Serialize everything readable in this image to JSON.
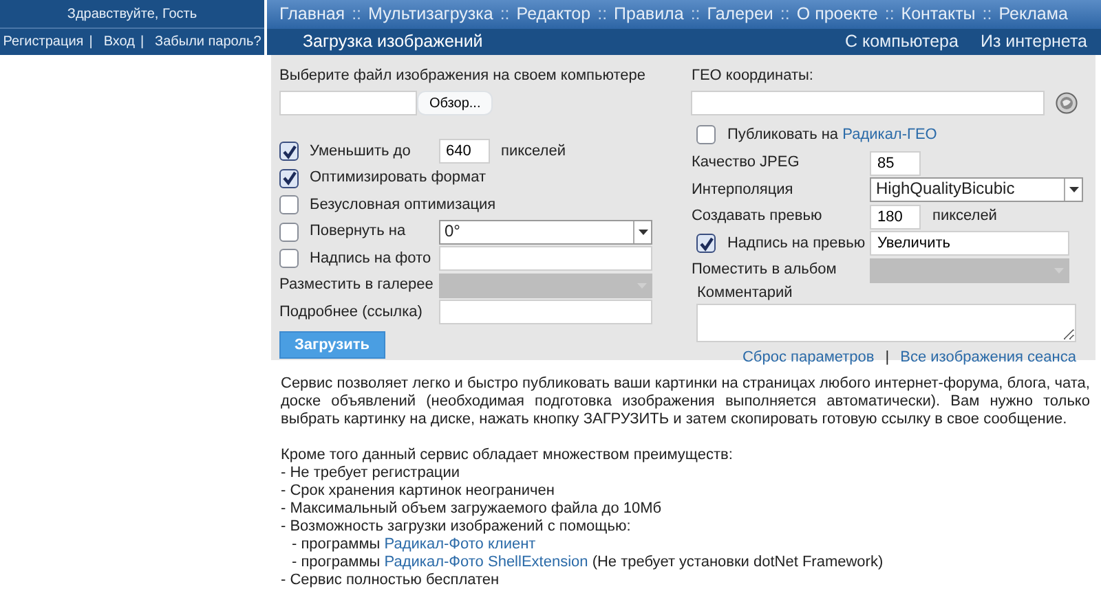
{
  "sidebar": {
    "greeting": "Здравствуйте, Гость",
    "links": [
      {
        "label": "Регистрация",
        "separator": "|"
      },
      {
        "label": "Вход",
        "separator": "|"
      },
      {
        "label": "Забыли пароль?"
      }
    ]
  },
  "nav": {
    "items": [
      {
        "label": "Главная"
      },
      {
        "label": "Мультизагрузка",
        "separator": "::"
      },
      {
        "label": "Редактор",
        "separator": "::"
      },
      {
        "label": "Правила",
        "separator": "::"
      },
      {
        "label": "Галереи",
        "separator": "::"
      },
      {
        "label": "О проекте",
        "separator": "::"
      },
      {
        "label": "Контакты",
        "separator": "::"
      },
      {
        "label": "Реклама",
        "separator": "::"
      }
    ]
  },
  "upload": {
    "title": "Загрузка изображений",
    "source_tabs": [
      "С компьютера",
      "Из интернета"
    ],
    "file_label": "Выберите файл изображения на своем компьютере",
    "browse_button": "Обзор...",
    "left_rows": [
      {
        "label": "Уменьшить до",
        "checked": true,
        "control": {
          "kind": "number",
          "value": "640",
          "suffix": "пикселей"
        }
      },
      {
        "label": "Оптимизировать формат",
        "checked": true
      },
      {
        "label": "Безусловная оптимизация",
        "checked": false
      },
      {
        "label": "Повернуть на",
        "checked": false,
        "control": {
          "kind": "select",
          "value": "0°"
        }
      },
      {
        "label": "Надпись на фото",
        "checked": false,
        "control": {
          "kind": "text"
        }
      },
      {
        "label": "Разместить в галерее",
        "control": {
          "kind": "select",
          "disabled": true
        }
      },
      {
        "label": "Подробнее (ссылка)",
        "control": {
          "kind": "text"
        }
      }
    ],
    "geo_label": "ГЕО координаты:",
    "geo_publish": {
      "checked": false,
      "text": "Публиковать на ",
      "link": "Радикал-ГЕО"
    },
    "right_rows": [
      {
        "label": "Качество JPEG",
        "control": {
          "kind": "number",
          "value": "85"
        }
      },
      {
        "label": "Интерполяция",
        "control": {
          "kind": "select",
          "value": "HighQualityBicubic"
        }
      },
      {
        "label": "Создавать превью",
        "control": {
          "kind": "number",
          "value": "180",
          "suffix": "пикселей"
        }
      },
      {
        "label": "Надпись на превью",
        "checked": true,
        "control": {
          "kind": "text",
          "value": "Увеличить"
        }
      },
      {
        "label": "Поместить в альбом",
        "control": {
          "kind": "select",
          "disabled": true
        }
      }
    ],
    "comment_label": "Комментарий",
    "submit_button": "Загрузить",
    "footer_links": [
      {
        "label": "Сброс параметров",
        "separator": "|"
      },
      {
        "label": "Все изображения сеанса"
      }
    ]
  },
  "about": {
    "intro": "Сервис позволяет легко и быстро публиковать ваши картинки на страницах любого интернет-форума, блога, чата, доске объявлений (необходимая подготовка изображения выполняется автоматически). Вам нужно только выбрать картинку на диске, нажать кнопку ЗАГРУЗИТЬ и затем скопировать готовую ссылку в свое сообщение.",
    "lead": "Кроме того данный сервис обладает множеством преимуществ:",
    "items": [
      {
        "text": "- Не требует регистрации"
      },
      {
        "text": "- Срок хранения картинок неограничен"
      },
      {
        "text": "- Максимальный объем загружаемого файла до 10Мб"
      },
      {
        "text": "- Возможность загрузки изображений с помощью:",
        "children": [
          {
            "text": "- программы ",
            "link": "Радикал-Фото клиент"
          },
          {
            "text": "- программы ",
            "link": "Радикал-Фото ShellExtension",
            "after": " (Не требует установки dotNet Framework)"
          }
        ]
      },
      {
        "text": "- Сервис полностью бесплатен"
      }
    ]
  }
}
